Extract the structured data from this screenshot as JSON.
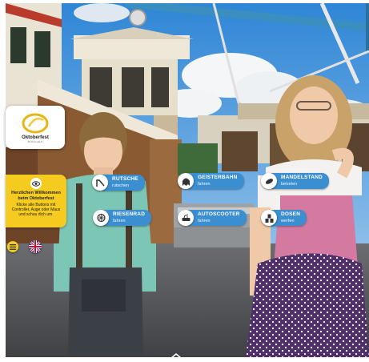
{
  "logo": {
    "brand": "Oktoberfest",
    "sub": "MÜNCHEN"
  },
  "welcome": {
    "icon": "eye-icon",
    "title": "Herzlichen Willkommen beim Oktoberfest",
    "text": "Klicke alle Buttons mit Controller, Auge oder Maus und schau dich um."
  },
  "hotspots": [
    {
      "id": "rutsche",
      "icon": "slide-icon",
      "title": "RUTSCHE",
      "sub": "rutschen"
    },
    {
      "id": "geisterbahn",
      "icon": "ghost-icon",
      "title": "GEISTERBAHN",
      "sub": "fahren"
    },
    {
      "id": "mandelstand",
      "icon": "almond-icon",
      "title": "MANDELSTAND",
      "sub": "betreten"
    },
    {
      "id": "riesenrad",
      "icon": "ferris-wheel-icon",
      "title": "RIESENRAD",
      "sub": "fahren"
    },
    {
      "id": "autoscooter",
      "icon": "bumper-car-icon",
      "title": "AUTOSCOOTER",
      "sub": "fahren"
    },
    {
      "id": "dosen",
      "icon": "cans-icon",
      "title": "DOSEN",
      "sub": "werfen"
    }
  ],
  "controls": {
    "menu_icon": "menu-icon",
    "language_icon": "uk-flag-icon",
    "nav_icon": "chevron-up-icon"
  },
  "colors": {
    "hotspot_blue": "#3b8fd0",
    "accent_yellow": "#f5cb1f"
  }
}
